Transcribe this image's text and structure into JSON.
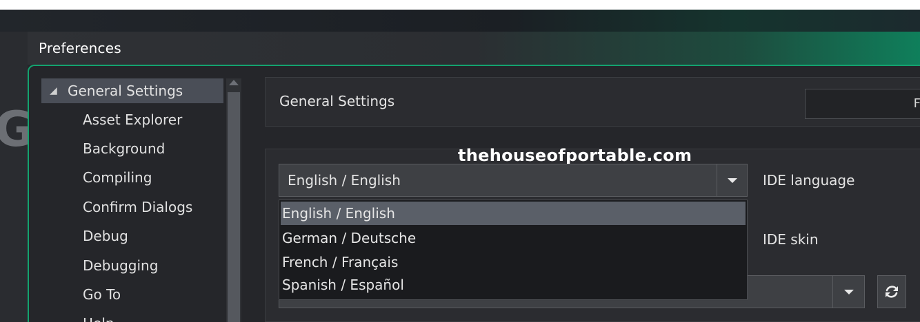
{
  "window": {
    "title": "Preferences"
  },
  "backdrop": {
    "logo_fragment": "G"
  },
  "watermark": "thehouseofportable.com",
  "sidebar": {
    "root_label": "General Settings",
    "items": [
      {
        "label": "Asset Explorer"
      },
      {
        "label": "Background"
      },
      {
        "label": "Compiling"
      },
      {
        "label": "Confirm Dialogs"
      },
      {
        "label": "Debug"
      },
      {
        "label": "Debugging"
      },
      {
        "label": "Go To"
      },
      {
        "label": "Help"
      }
    ]
  },
  "header": {
    "title": "General Settings",
    "button_label": "F"
  },
  "settings": {
    "language": {
      "label": "IDE language",
      "selected": "English / English",
      "options": [
        {
          "label": "English / English",
          "highlighted": true
        },
        {
          "label": "German / Deutsche",
          "highlighted": false
        },
        {
          "label": "French / Français",
          "highlighted": false
        },
        {
          "label": "Spanish / Español",
          "highlighted": false
        }
      ]
    },
    "skin": {
      "label": "IDE skin"
    }
  },
  "colors": {
    "accent": "#13a36f",
    "selection": "#4a4e57",
    "highlight": "#5a5f68"
  },
  "icons": {
    "tree_expand": "triangle-down-icon",
    "dropdown": "chevron-down-icon",
    "refresh": "refresh-icon"
  }
}
